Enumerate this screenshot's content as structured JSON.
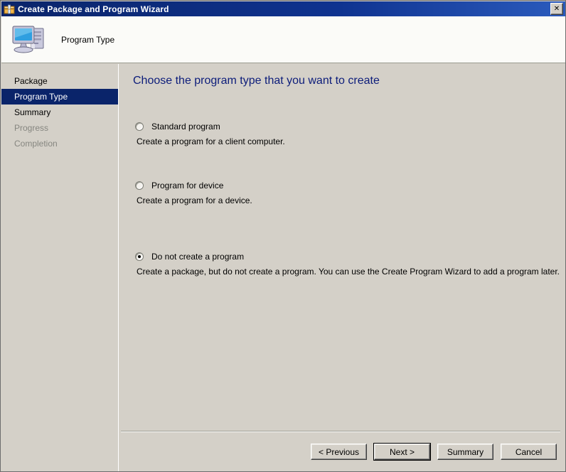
{
  "window": {
    "title": "Create Package and Program Wizard",
    "title_icon": "package-wizard-icon",
    "close_label": "✕"
  },
  "header": {
    "icon": "computer-monitor-icon",
    "title": "Program Type"
  },
  "sidebar": {
    "items": [
      {
        "label": "Package",
        "state": "normal"
      },
      {
        "label": "Program Type",
        "state": "selected"
      },
      {
        "label": "Summary",
        "state": "normal"
      },
      {
        "label": "Progress",
        "state": "disabled"
      },
      {
        "label": "Completion",
        "state": "disabled"
      }
    ]
  },
  "main": {
    "heading": "Choose the program type that you want to create",
    "options": [
      {
        "label": "Standard program",
        "description": "Create a program for a client computer.",
        "checked": false
      },
      {
        "label": "Program for device",
        "description": "Create a program for a device.",
        "checked": false
      },
      {
        "label": "Do not create a program",
        "description": "Create a package, but do not create a program. You can use the Create Program Wizard to add a program later.",
        "checked": true
      }
    ]
  },
  "footer": {
    "buttons": [
      {
        "label": "< Previous",
        "default": false
      },
      {
        "label": "Next >",
        "default": true
      },
      {
        "label": "Summary",
        "default": false
      },
      {
        "label": "Cancel",
        "default": false
      }
    ]
  },
  "colors": {
    "titlebar": "#0a246a",
    "dialog_face": "#d4d0c8",
    "heading_text": "#0c1c7a",
    "selected_nav": "#0a246a",
    "disabled_text": "#868680",
    "header_band": "#fbfbf8"
  }
}
